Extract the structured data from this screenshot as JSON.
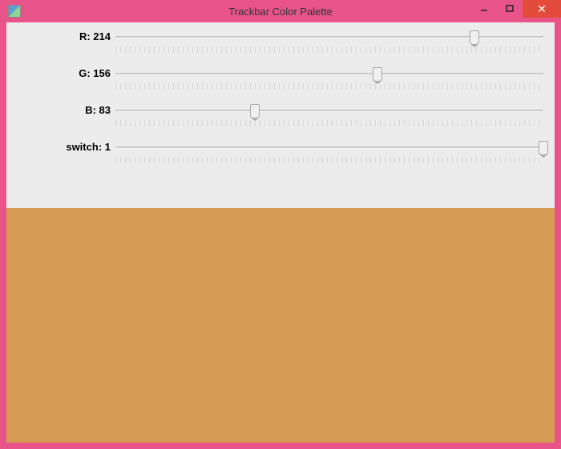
{
  "window": {
    "title": "Trackbar Color Palette"
  },
  "trackbars": {
    "r": {
      "label": "R",
      "value": 214,
      "max": 255
    },
    "g": {
      "label": "G",
      "value": 156,
      "max": 255
    },
    "b": {
      "label": "B",
      "value": 83,
      "max": 255
    },
    "switch": {
      "label": "switch",
      "value": 1,
      "max": 1
    }
  },
  "preview_color": "#d69c53"
}
